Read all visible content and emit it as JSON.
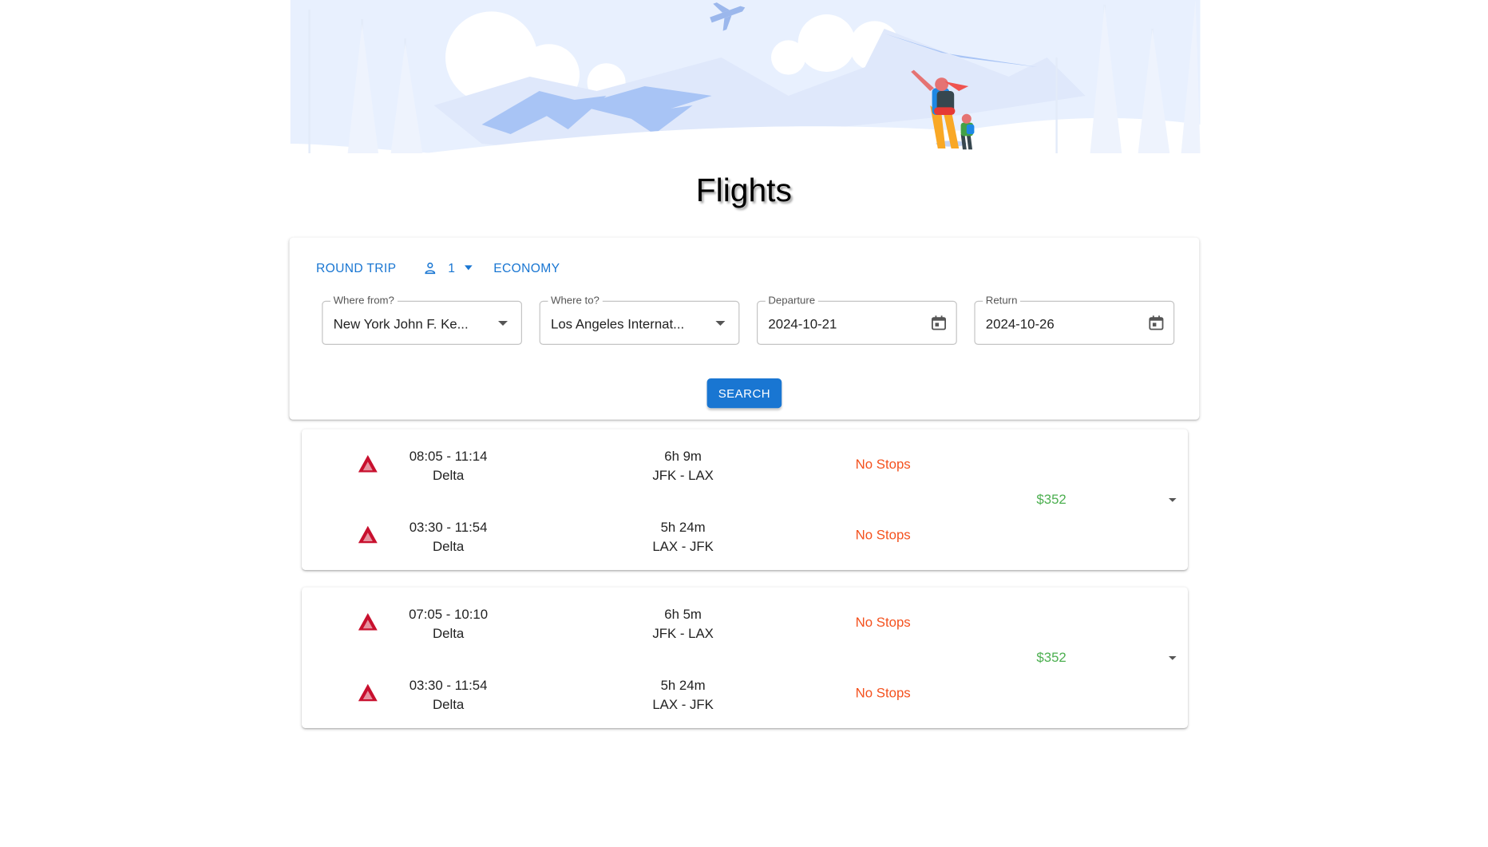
{
  "page": {
    "title": "Flights"
  },
  "search": {
    "options": {
      "trip_type": "Round trip",
      "passengers": "1",
      "cabin_class": "Economy"
    },
    "from": {
      "label": "Where from?",
      "value": "New York John F. Ke..."
    },
    "to": {
      "label": "Where to?",
      "value": "Los Angeles Internat..."
    },
    "departure": {
      "label": "Departure",
      "value": "2024-10-21"
    },
    "return": {
      "label": "Return",
      "value": "2024-10-26"
    },
    "search_button": "Search"
  },
  "results": [
    {
      "price": "$352",
      "outbound": {
        "times": "08:05 - 11:14",
        "airline": "Delta",
        "duration": "6h 9m",
        "route": "JFK - LAX",
        "stops": "No Stops"
      },
      "inbound": {
        "times": "03:30 - 11:54",
        "airline": "Delta",
        "duration": "5h 24m",
        "route": "LAX - JFK",
        "stops": "No Stops"
      }
    },
    {
      "price": "$352",
      "outbound": {
        "times": "07:05 - 10:10",
        "airline": "Delta",
        "duration": "6h 5m",
        "route": "JFK - LAX",
        "stops": "No Stops"
      },
      "inbound": {
        "times": "03:30 - 11:54",
        "airline": "Delta",
        "duration": "5h 24m",
        "route": "LAX - JFK",
        "stops": "No Stops"
      }
    }
  ],
  "colors": {
    "accent": "#1976d2",
    "stops": "#f4511e",
    "price": "#4caf50",
    "airline_logo": "#c8102e"
  },
  "icons": {
    "passenger": "person-icon",
    "date": "calendar-icon",
    "airline": "delta-logo-icon"
  }
}
